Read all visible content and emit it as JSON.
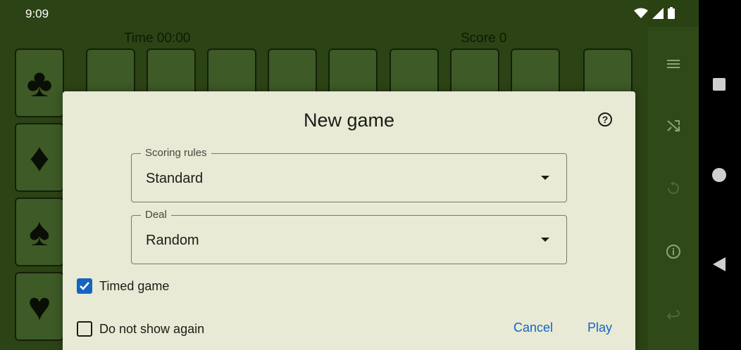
{
  "status_bar": {
    "time": "9:09",
    "icons": [
      "wifi-icon",
      "signal-icon",
      "battery-icon"
    ]
  },
  "hud": {
    "time": "Time 00:00",
    "score": "Score 0"
  },
  "foundations": [
    {
      "suit": "clubs",
      "glyph": "♣"
    },
    {
      "suit": "diamonds",
      "glyph": "♦"
    },
    {
      "suit": "spades",
      "glyph": "♠"
    },
    {
      "suit": "hearts",
      "glyph": "♥"
    }
  ],
  "rail": {
    "icons": [
      "menu-icon",
      "shuffle-icon",
      "restart-icon",
      "info-icon",
      "undo-icon"
    ]
  },
  "dialog": {
    "title": "New game",
    "help_icon": "help-icon",
    "scoring": {
      "label": "Scoring rules",
      "value": "Standard"
    },
    "deal": {
      "label": "Deal",
      "value": "Random"
    },
    "timed_game": {
      "label": "Timed game",
      "checked": true
    },
    "do_not_show": {
      "label": "Do not show again",
      "checked": false
    },
    "cancel_label": "Cancel",
    "play_label": "Play"
  },
  "colors": {
    "accent": "#1565c0",
    "table": "#2c4315",
    "dialog_bg": "#e8ead6"
  }
}
